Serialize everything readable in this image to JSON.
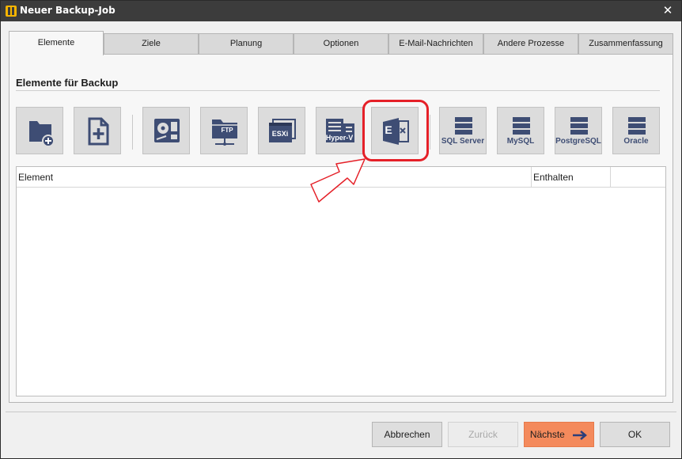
{
  "window": {
    "title": "Neuer Backup-Job",
    "close_glyph": "✕"
  },
  "tabs": [
    {
      "label": "Elemente",
      "active": true
    },
    {
      "label": "Ziele",
      "active": false
    },
    {
      "label": "Planung",
      "active": false
    },
    {
      "label": "Optionen",
      "active": false
    },
    {
      "label": "E-Mail-Nachrichten",
      "active": false
    },
    {
      "label": "Andere Prozesse",
      "active": false
    },
    {
      "label": "Zusammenfassung",
      "active": false
    }
  ],
  "section": {
    "title": "Elemente für Backup"
  },
  "tools": [
    {
      "icon": "folder-add-icon",
      "label": ""
    },
    {
      "icon": "file-add-icon",
      "label": ""
    },
    {
      "icon": "disk-image-icon",
      "label": ""
    },
    {
      "icon": "ftp-folder-icon",
      "label": "FTP"
    },
    {
      "icon": "esxi-icon",
      "label": "ESXi"
    },
    {
      "icon": "hyper-v-icon",
      "label": "Hyper-V"
    },
    {
      "icon": "exchange-icon",
      "label": "E"
    },
    {
      "icon": "database-icon",
      "label": "SQL Server"
    },
    {
      "icon": "database-icon",
      "label": "MySQL"
    },
    {
      "icon": "database-icon",
      "label": "PostgreSQL"
    },
    {
      "icon": "database-icon",
      "label": "Oracle"
    }
  ],
  "list": {
    "columns": [
      "Element",
      "Enthalten"
    ],
    "rows": []
  },
  "buttons": {
    "cancel": "Abbrechen",
    "back": "Zurück",
    "next": "Nächste",
    "ok": "OK"
  },
  "colors": {
    "icon": "#3e4d74",
    "highlight": "#e52028",
    "primary": "#f48a5c",
    "titlebar": "#3c3c3c"
  }
}
